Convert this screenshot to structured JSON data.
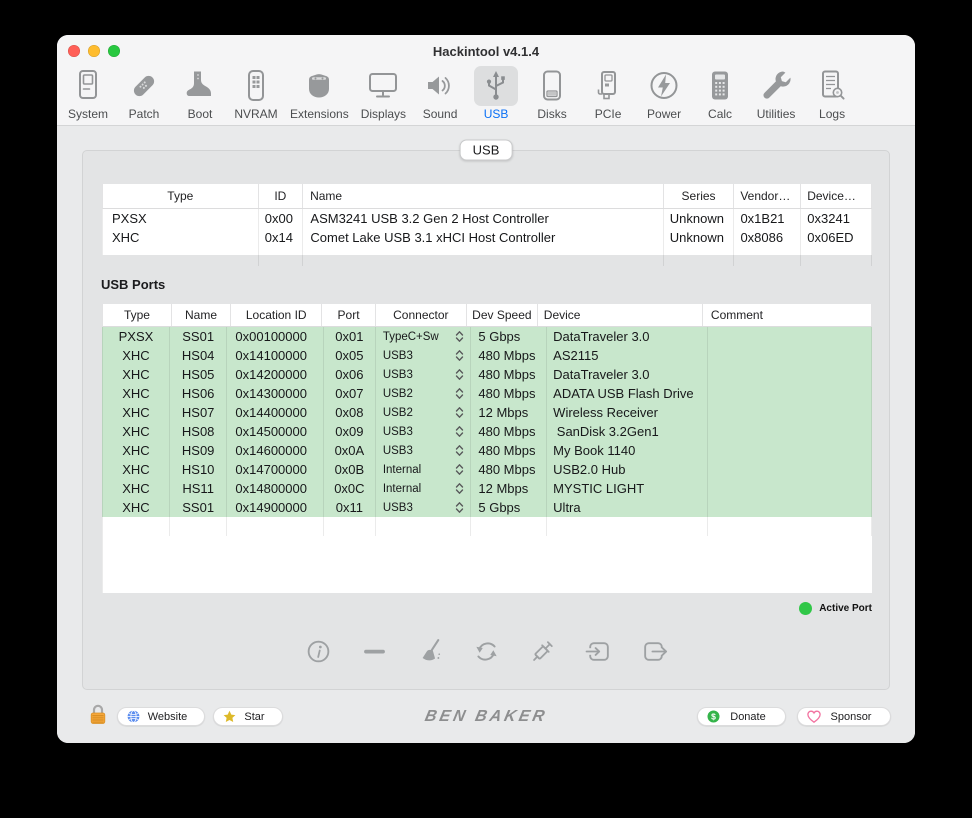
{
  "window": {
    "title": "Hackintool v4.1.4"
  },
  "toolbar": {
    "selected_color": "#0a70f5",
    "items": [
      {
        "label": "System",
        "icon": "system-icon",
        "selected": false
      },
      {
        "label": "Patch",
        "icon": "patch-icon",
        "selected": false
      },
      {
        "label": "Boot",
        "icon": "boot-icon",
        "selected": false
      },
      {
        "label": "NVRAM",
        "icon": "nvram-icon",
        "selected": false
      },
      {
        "label": "Extensions",
        "icon": "extensions-icon",
        "selected": false
      },
      {
        "label": "Displays",
        "icon": "displays-icon",
        "selected": false
      },
      {
        "label": "Sound",
        "icon": "sound-icon",
        "selected": false
      },
      {
        "label": "USB",
        "icon": "usb-icon",
        "selected": true
      },
      {
        "label": "Disks",
        "icon": "disks-icon",
        "selected": false
      },
      {
        "label": "PCIe",
        "icon": "pcie-icon",
        "selected": false
      },
      {
        "label": "Power",
        "icon": "power-icon",
        "selected": false
      },
      {
        "label": "Calc",
        "icon": "calc-icon",
        "selected": false
      },
      {
        "label": "Utilities",
        "icon": "utilities-icon",
        "selected": false
      },
      {
        "label": "Logs",
        "icon": "logs-icon",
        "selected": false
      }
    ]
  },
  "tab_pill": {
    "label": "USB"
  },
  "controllers": {
    "columns": [
      "Type",
      "ID",
      "Name",
      "Series",
      "Vendor…",
      "Device…"
    ],
    "rows": [
      {
        "type": "PXSX",
        "id": "0x00",
        "name": "ASM3241 USB 3.2 Gen 2 Host Controller",
        "series": "Unknown",
        "vendor": "0x1B21",
        "device": "0x3241"
      },
      {
        "type": "XHC",
        "id": "0x14",
        "name": "Comet Lake USB 3.1 xHCI Host Controller",
        "series": "Unknown",
        "vendor": "0x8086",
        "device": "0x06ED"
      }
    ]
  },
  "usb_ports": {
    "title": "USB Ports",
    "columns": [
      "Type",
      "Name",
      "Location ID",
      "Port",
      "Connector",
      "Dev Speed",
      "Device",
      "Comment"
    ],
    "active_row_color": "#c8e7cc",
    "rows": [
      {
        "type": "PXSX",
        "name": "SS01",
        "location_id": "0x00100000",
        "port": "0x01",
        "connector": "TypeC+Sw",
        "dev_speed": "5 Gbps",
        "device": "DataTraveler 3.0",
        "comment": "",
        "active": true
      },
      {
        "type": "XHC",
        "name": "HS04",
        "location_id": "0x14100000",
        "port": "0x05",
        "connector": "USB3",
        "dev_speed": "480 Mbps",
        "device": "AS2115",
        "comment": "",
        "active": true
      },
      {
        "type": "XHC",
        "name": "HS05",
        "location_id": "0x14200000",
        "port": "0x06",
        "connector": "USB3",
        "dev_speed": "480 Mbps",
        "device": "DataTraveler 3.0",
        "comment": "",
        "active": true
      },
      {
        "type": "XHC",
        "name": "HS06",
        "location_id": "0x14300000",
        "port": "0x07",
        "connector": "USB2",
        "dev_speed": "480 Mbps",
        "device": "ADATA USB Flash Drive",
        "comment": "",
        "active": true
      },
      {
        "type": "XHC",
        "name": "HS07",
        "location_id": "0x14400000",
        "port": "0x08",
        "connector": "USB2",
        "dev_speed": "12 Mbps",
        "device": "Wireless Receiver",
        "comment": "",
        "active": true
      },
      {
        "type": "XHC",
        "name": "HS08",
        "location_id": "0x14500000",
        "port": "0x09",
        "connector": "USB3",
        "dev_speed": "480 Mbps",
        "device": " SanDisk 3.2Gen1",
        "comment": "",
        "active": true
      },
      {
        "type": "XHC",
        "name": "HS09",
        "location_id": "0x14600000",
        "port": "0x0A",
        "connector": "USB3",
        "dev_speed": "480 Mbps",
        "device": "My Book 1140",
        "comment": "",
        "active": true
      },
      {
        "type": "XHC",
        "name": "HS10",
        "location_id": "0x14700000",
        "port": "0x0B",
        "connector": "Internal",
        "dev_speed": "480 Mbps",
        "device": "USB2.0 Hub",
        "comment": "",
        "active": true
      },
      {
        "type": "XHC",
        "name": "HS11",
        "location_id": "0x14800000",
        "port": "0x0C",
        "connector": "Internal",
        "dev_speed": "12 Mbps",
        "device": "MYSTIC LIGHT",
        "comment": "",
        "active": true
      },
      {
        "type": "XHC",
        "name": "SS01",
        "location_id": "0x14900000",
        "port": "0x11",
        "connector": "USB3",
        "dev_speed": "5 Gbps",
        "device": "Ultra",
        "comment": "",
        "active": true
      }
    ]
  },
  "legend": {
    "active_port": "Active Port",
    "dot_color": "#31c748"
  },
  "actions": {
    "icons": [
      "info-icon",
      "remove-icon",
      "clean-icon",
      "refresh-icon",
      "inject-icon",
      "import-icon",
      "export-icon"
    ]
  },
  "footer": {
    "lock_icon": "lock-icon",
    "website_label": "Website",
    "star_label": "Star",
    "brand": "BEN BAKER",
    "donate_label": "Donate",
    "sponsor_label": "Sponsor"
  }
}
